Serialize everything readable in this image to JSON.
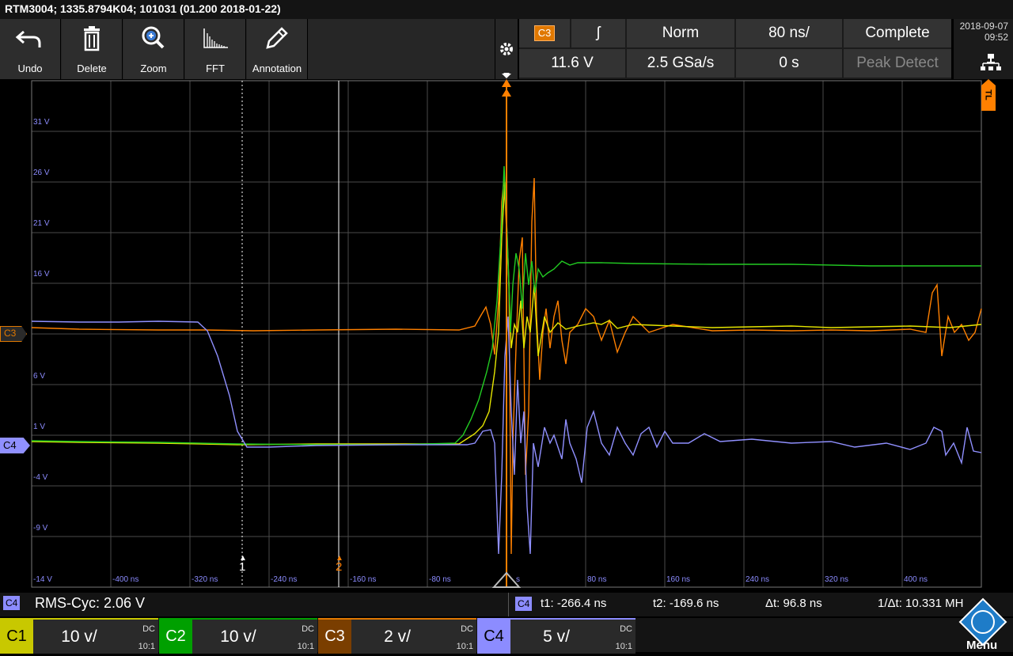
{
  "title": "RTM3004; 1335.8794K04; 101031 (01.200 2018-01-22)",
  "toolbar": [
    {
      "label": "Undo",
      "icon": "undo-icon"
    },
    {
      "label": "Delete",
      "icon": "trash-icon"
    },
    {
      "label": "Zoom",
      "icon": "zoom-icon"
    },
    {
      "label": "FFT",
      "icon": "fft-icon"
    },
    {
      "label": "Annotation",
      "icon": "pencil-icon"
    }
  ],
  "trigger": {
    "source": "C3",
    "slope": "ʃ",
    "mode": "Norm",
    "timebase": "80 ns/",
    "acq_state": "Complete",
    "level": "11.6 V",
    "sample_rate": "2.5 GSa/s",
    "position": "0 s",
    "acq_mode": "Peak Detect"
  },
  "clock": {
    "date": "2018-09-07",
    "time": "09:52"
  },
  "markers": {
    "ch3": "C3",
    "ch4": "C4",
    "tl": "TL",
    "cursor1": "1",
    "cursor2": "2"
  },
  "y_ticks": [
    "31 V",
    "26 V",
    "21 V",
    "16 V",
    "6 V",
    "1 V",
    "-4 V",
    "-9 V",
    "-14 V"
  ],
  "x_ticks": [
    "-400 ns",
    "-320 ns",
    "-240 ns",
    "-160 ns",
    "-80 ns",
    "s",
    "80 ns",
    "160 ns",
    "240 ns",
    "320 ns",
    "400 ns"
  ],
  "measurement": {
    "channel": "C4",
    "text": "RMS-Cyc: 2.06 V"
  },
  "cursor_readout": {
    "channel": "C4",
    "t1": "t1: -266.4 ns",
    "t2": "t2: -169.6 ns",
    "dt": "Δt: 96.8 ns",
    "inv": "1/Δt: 10.331 MH"
  },
  "channels": [
    {
      "name": "C1",
      "scale": "10 v/",
      "coupling": "DC",
      "probe": "10:1",
      "color": "#c8c800"
    },
    {
      "name": "C2",
      "scale": "10 v/",
      "coupling": "DC",
      "probe": "10:1",
      "color": "#00a000"
    },
    {
      "name": "C3",
      "scale": "2 v/",
      "coupling": "DC",
      "probe": "10:1",
      "color": "#e07800"
    },
    {
      "name": "C4",
      "scale": "5 v/",
      "coupling": "DC",
      "probe": "10:1",
      "color": "#8c8cff"
    }
  ],
  "menu_label": "Menu",
  "colors": {
    "c1": "#e6e600",
    "c2": "#22cc22",
    "c3": "#ff8000",
    "c4": "#9090ff",
    "grid": "#4a4a4a"
  }
}
